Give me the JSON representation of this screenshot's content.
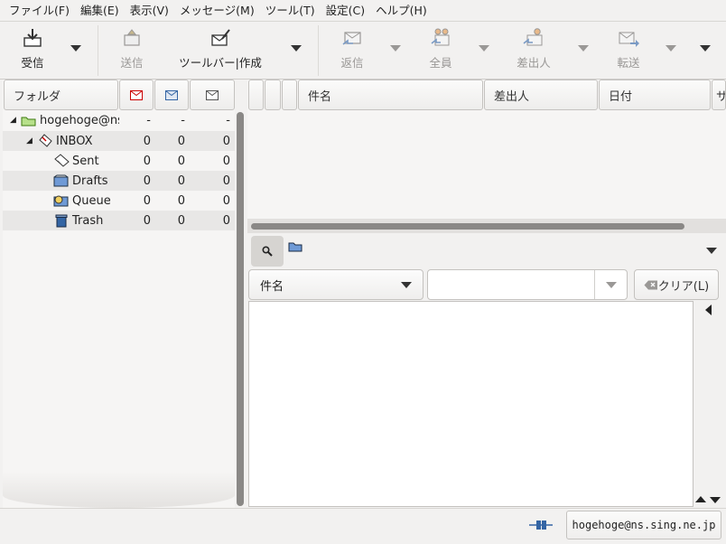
{
  "menubar": [
    "ファイル(F)",
    "編集(E)",
    "表示(V)",
    "メッセージ(M)",
    "ツール(T)",
    "設定(C)",
    "ヘルプ(H)"
  ],
  "toolbar": {
    "receive": "受信",
    "send": "送信",
    "compose": "ツールバー|作成",
    "reply": "返信",
    "reply_all": "全員",
    "reply_sender": "差出人",
    "forward": "転送"
  },
  "folder_pane": {
    "header": "フォルダ",
    "account": {
      "name": "hogehoge@ns",
      "new": "-",
      "unread": "-",
      "total": "-"
    },
    "folders": [
      {
        "name": "INBOX",
        "new": "0",
        "unread": "0",
        "total": "0"
      },
      {
        "name": "Sent",
        "new": "0",
        "unread": "0",
        "total": "0"
      },
      {
        "name": "Drafts",
        "new": "0",
        "unread": "0",
        "total": "0"
      },
      {
        "name": "Queue",
        "new": "0",
        "unread": "0",
        "total": "0"
      },
      {
        "name": "Trash",
        "new": "0",
        "unread": "0",
        "total": "0"
      }
    ]
  },
  "message_list": {
    "columns": [
      "件名",
      "差出人",
      "日付",
      "サ"
    ]
  },
  "quick_search": {
    "field": "件名",
    "value": "",
    "clear_label": "クリア(L)"
  },
  "status": {
    "account": "hogehoge@ns.sing.ne.jp"
  },
  "colors": {
    "accent_blue": "#3465a4",
    "mark_red": "#cc0000",
    "folder_green": "#4e9a06"
  }
}
